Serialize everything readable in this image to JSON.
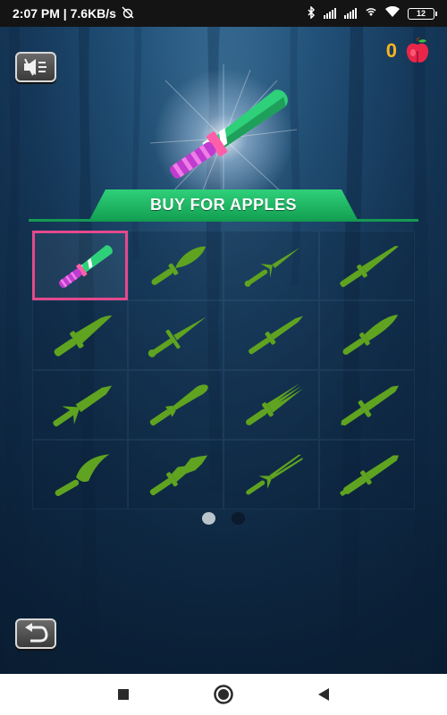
{
  "status_bar": {
    "time_speed": "2:07 PM | 7.6KB/s",
    "battery": "12"
  },
  "store": {
    "apple_count": "0",
    "banner_label": "BUY FOR APPLES",
    "knife_slots": [
      {
        "name": "candy knife",
        "selected": true,
        "locked": false
      },
      {
        "name": "leaf blade",
        "locked": true
      },
      {
        "name": "twin-spike blade",
        "locked": true
      },
      {
        "name": "long blade",
        "locked": true
      },
      {
        "name": "wide dagger",
        "locked": true
      },
      {
        "name": "cross-guard dagger",
        "locked": true
      },
      {
        "name": "slim dagger",
        "locked": true
      },
      {
        "name": "curved dagger",
        "locked": true
      },
      {
        "name": "spiked-hilt dagger",
        "locked": true
      },
      {
        "name": "flared blade",
        "locked": true
      },
      {
        "name": "fork blade",
        "locked": true
      },
      {
        "name": "serrated dagger",
        "locked": true
      },
      {
        "name": "kukri",
        "locked": true
      },
      {
        "name": "jagged blade",
        "locked": true
      },
      {
        "name": "split-tip blade",
        "locked": true
      },
      {
        "name": "tiered dagger",
        "locked": true
      }
    ],
    "pages": {
      "count": 2,
      "current": 1
    }
  },
  "colors": {
    "locked_knife": "#5fa320",
    "selected_border": "#e4498d",
    "banner_green": "#1dbb63",
    "apple_count": "#f7b41f"
  },
  "icons": {
    "sound": "speaker-muted-icon",
    "apple": "apple-icon",
    "back": "back-arrow-icon"
  }
}
